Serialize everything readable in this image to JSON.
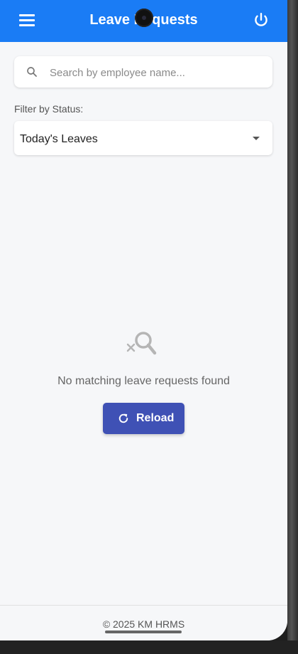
{
  "appbar": {
    "title": "Leave Requests",
    "menu_icon": "hamburger-menu-icon",
    "power_icon": "power-icon",
    "color": "#1a7cf5"
  },
  "search": {
    "placeholder": "Search by employee name...",
    "value": "",
    "icon": "search-icon"
  },
  "filter": {
    "label": "Filter by Status:",
    "selected": "Today's Leaves"
  },
  "empty_state": {
    "icon": "search-off-icon",
    "message": "No matching leave requests found",
    "reload_label": "Reload",
    "reload_icon": "refresh-icon",
    "button_color": "#3f51b5"
  },
  "footer": {
    "text": "© 2025 KM HRMS"
  }
}
